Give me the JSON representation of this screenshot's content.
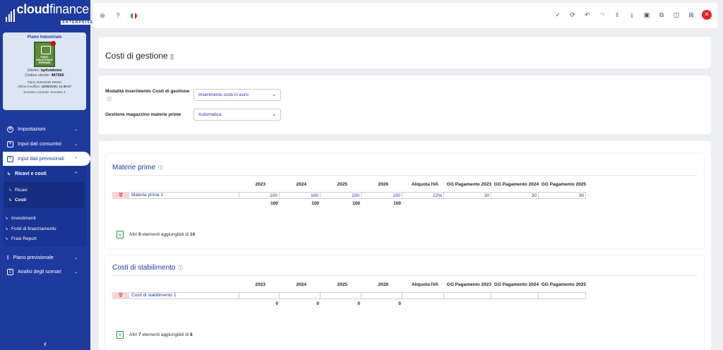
{
  "app": {
    "logo_bold": "cloud",
    "logo_light": "finance",
    "logo_sub": "ENTERPRISE"
  },
  "profile": {
    "title": "Piano Industriale",
    "badge_text": "PIANO INDUSTRIALE PREMIUM",
    "user_label": "Utente:",
    "user": "bpilotdemo",
    "code_label": "Codice utente:",
    "code": "487566",
    "plan": "Piano Industriale DEMO",
    "last_mod_label": "Ultima modifica:",
    "last_mod": "15/05/2025, 12:40:27",
    "scenario": "Scenario corrente: Scenario 1"
  },
  "sidebar": {
    "items": [
      {
        "label": "Impostazioni"
      },
      {
        "label": "Input dati consuntivi"
      },
      {
        "label": "Input dati previsionali"
      },
      {
        "label": "Ricavi e costi"
      },
      {
        "label": "Ricavi"
      },
      {
        "label": "Costi"
      },
      {
        "label": "Investimenti"
      },
      {
        "label": "Fonti di finanziamento"
      },
      {
        "label": "Frasi Report"
      },
      {
        "label": "Piano previsionale"
      },
      {
        "label": "Analisi degli scenari"
      }
    ]
  },
  "page": {
    "title": "Costi di gestione"
  },
  "settings": {
    "mode_label": "Modalità inserimento Costi di gestione",
    "mode_value": "Inserimento costi in euro",
    "warehouse_label": "Gestione magazzino materie prime",
    "warehouse_value": "Automatica"
  },
  "columns": [
    "2023",
    "2024",
    "2025",
    "2026",
    "Aliquota IVA",
    "GG Pagamento 2023",
    "GG Pagamento 2024",
    "GG Pagamento 2025"
  ],
  "materie": {
    "title": "Materie prime",
    "row_name": "Materia prima 1",
    "row_values": [
      "100",
      "100",
      "100",
      "100",
      "22%",
      "30",
      "30",
      "30"
    ],
    "totals": [
      "100",
      "100",
      "100",
      "100"
    ],
    "add_prefix": "Altri",
    "add_count": "9",
    "add_mid": "elementi aggiungibili di",
    "add_total": "10"
  },
  "stabilimento": {
    "title": "Costi di stabilimento",
    "row_name": "Costi di stabilimento 1",
    "row_values": [
      "",
      "",
      "",
      "",
      "",
      "",
      "",
      ""
    ],
    "totals": [
      "0",
      "0",
      "0",
      "0"
    ],
    "add_prefix": "Altri",
    "add_count": "7",
    "add_mid": "elementi aggiungibili di",
    "add_total": "8"
  }
}
